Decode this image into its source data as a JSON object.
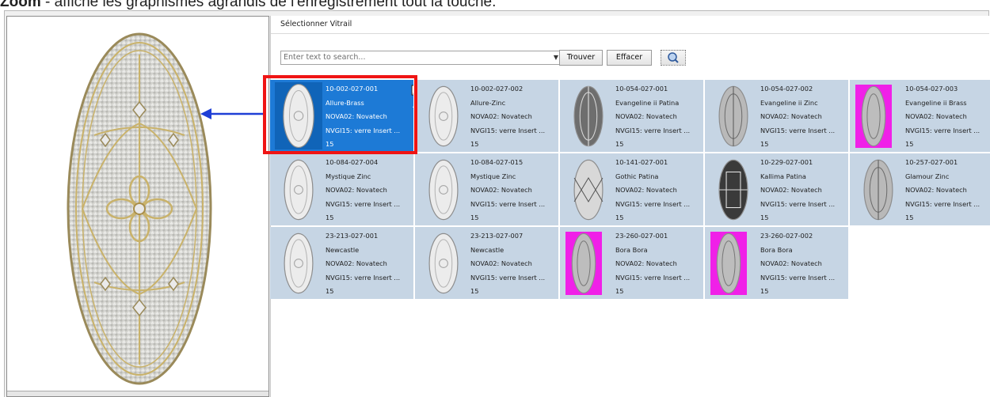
{
  "caption": {
    "lead": "Zoom",
    "text": " - affiche les graphismes agrandis de l'enregistrement tout la touche."
  },
  "dialog": {
    "title": "Sélectionner Vitrail",
    "search": {
      "placeholder": "Enter text to search...",
      "value": ""
    },
    "find_label": "Trouver",
    "clear_label": "Effacer",
    "zoom_icon": "magnifier-icon"
  },
  "items": [
    {
      "code": "10-002-027-001",
      "name": "Allure-Brass",
      "supplier": "NOVA02: Novatech",
      "category": "NVGI15: verre Insert ...",
      "qty": "15",
      "thumb": "oval-clear",
      "selected": true
    },
    {
      "code": "10-002-027-002",
      "name": "Allure-Zinc",
      "supplier": "NOVA02: Novatech",
      "category": "NVGI15: verre Insert ...",
      "qty": "15",
      "thumb": "oval-clear",
      "selected": false
    },
    {
      "code": "10-054-027-001",
      "name": "Evangeline ii Patina",
      "supplier": "NOVA02: Novatech",
      "category": "NVGI15: verre Insert ...",
      "qty": "15",
      "thumb": "oval-dark",
      "selected": false
    },
    {
      "code": "10-054-027-002",
      "name": "Evangeline ii Zinc",
      "supplier": "NOVA02: Novatech",
      "category": "NVGI15: verre Insert ...",
      "qty": "15",
      "thumb": "oval-grey",
      "selected": false
    },
    {
      "code": "10-054-027-003",
      "name": "Evangeline ii Brass",
      "supplier": "NOVA02: Novatech",
      "category": "NVGI15: verre Insert ...",
      "qty": "15",
      "thumb": "oval-magenta",
      "selected": false
    },
    {
      "code": "10-084-027-004",
      "name": "Mystique Zinc",
      "supplier": "NOVA02: Novatech",
      "category": "NVGI15: verre Insert ...",
      "qty": "15",
      "thumb": "oval-clear",
      "selected": false
    },
    {
      "code": "10-084-027-015",
      "name": "Mystique Zinc",
      "supplier": "NOVA02: Novatech",
      "category": "NVGI15: verre Insert ...",
      "qty": "15",
      "thumb": "oval-clear",
      "selected": false
    },
    {
      "code": "10-141-027-001",
      "name": "Gothic Patina",
      "supplier": "NOVA02: Novatech",
      "category": "NVGI15: verre Insert ...",
      "qty": "15",
      "thumb": "oval-diamond",
      "selected": false
    },
    {
      "code": "10-229-027-001",
      "name": "Kallima Patina",
      "supplier": "NOVA02: Novatech",
      "category": "NVGI15: verre Insert ...",
      "qty": "15",
      "thumb": "oval-black",
      "selected": false
    },
    {
      "code": "10-257-027-001",
      "name": "Glamour Zinc",
      "supplier": "NOVA02: Novatech",
      "category": "NVGI15: verre Insert ...",
      "qty": "15",
      "thumb": "oval-grey",
      "selected": false
    },
    {
      "code": "23-213-027-001",
      "name": "Newcastle",
      "supplier": "NOVA02: Novatech",
      "category": "NVGI15: verre Insert ...",
      "qty": "15",
      "thumb": "oval-clear",
      "selected": false
    },
    {
      "code": "23-213-027-007",
      "name": "Newcastle",
      "supplier": "NOVA02: Novatech",
      "category": "NVGI15: verre Insert ...",
      "qty": "15",
      "thumb": "oval-clear",
      "selected": false
    },
    {
      "code": "23-260-027-001",
      "name": "Bora Bora",
      "supplier": "NOVA02: Novatech",
      "category": "NVGI15: verre Insert ...",
      "qty": "15",
      "thumb": "oval-magenta",
      "selected": false
    },
    {
      "code": "23-260-027-002",
      "name": "Bora Bora",
      "supplier": "NOVA02: Novatech",
      "category": "NVGI15: verre Insert ...",
      "qty": "15",
      "thumb": "oval-magenta",
      "selected": false
    }
  ],
  "preview": {
    "image": "glass-insert-oval-brass"
  },
  "colors": {
    "cell_bg": "#c6d5e4",
    "selected_bg": "#1d7ad6",
    "highlight_border": "#ef1414",
    "arrow": "#1f3fd6",
    "magenta_bg": "#f020e8"
  }
}
